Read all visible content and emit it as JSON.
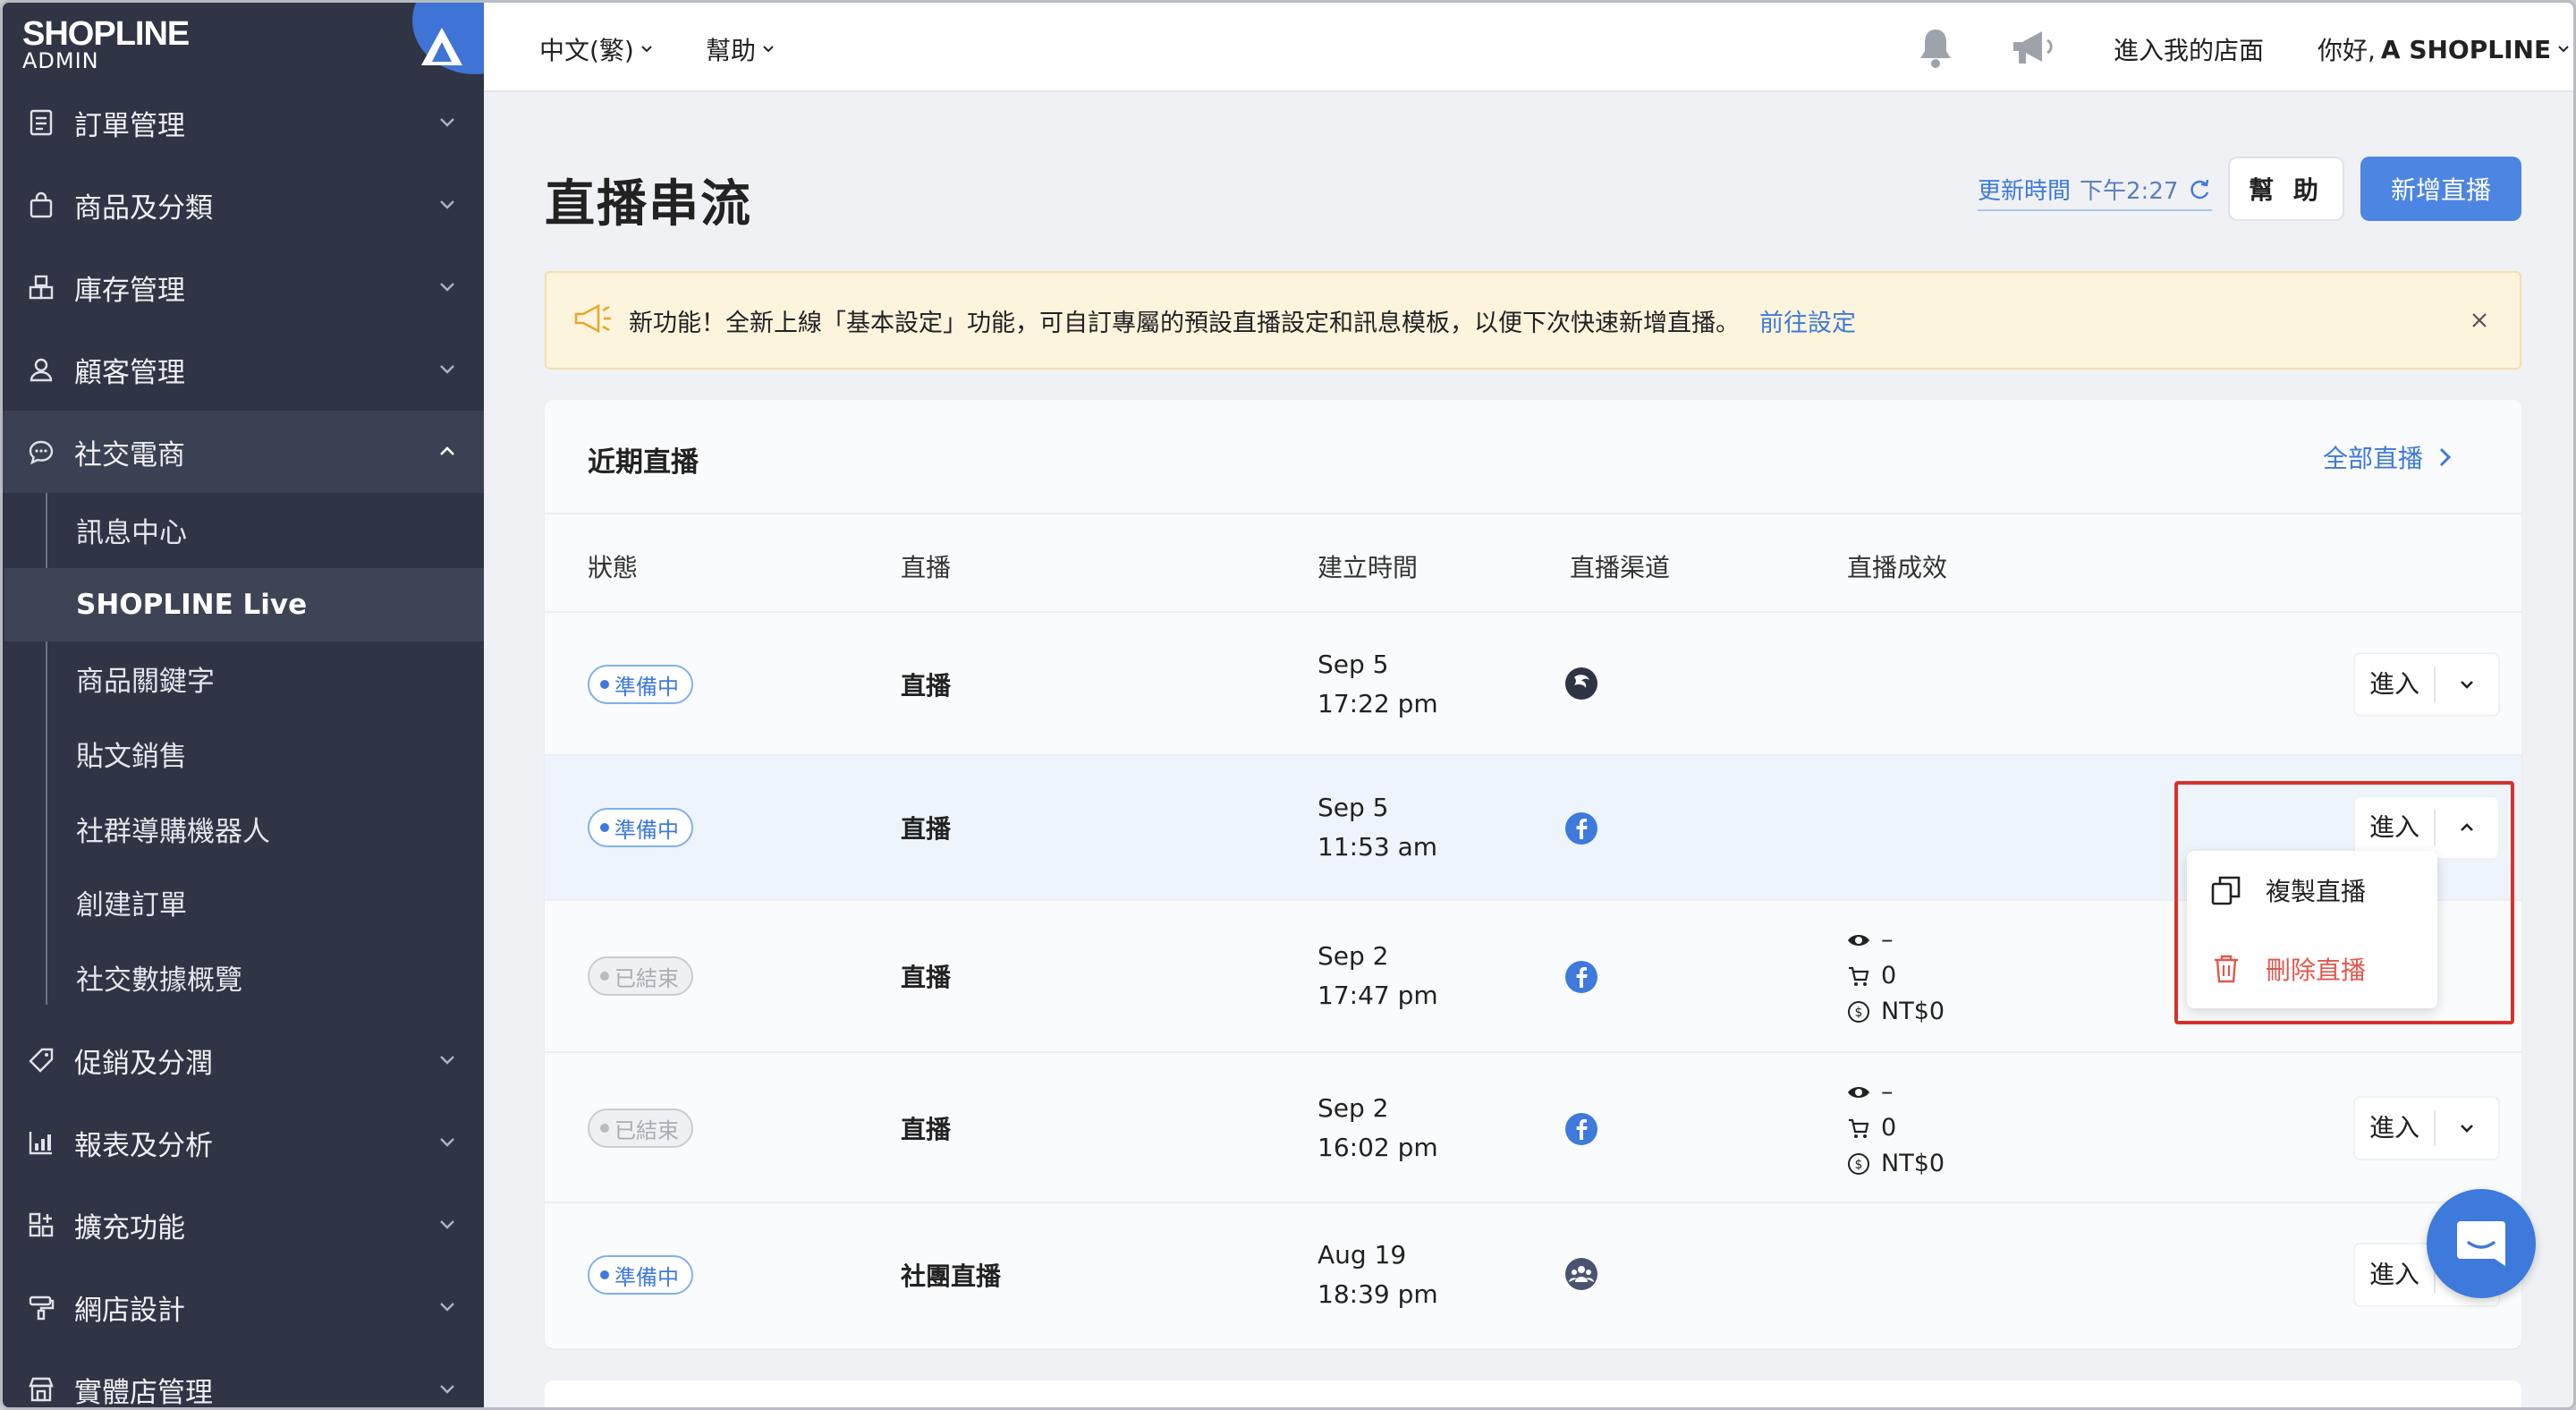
{
  "brand": {
    "logo": "SHOPLINE",
    "sub": "ADMIN",
    "accent": "#3f74d6"
  },
  "sidebar": {
    "items": [
      {
        "label": "訂單管理",
        "icon": "order-icon"
      },
      {
        "label": "商品及分類",
        "icon": "bag-icon"
      },
      {
        "label": "庫存管理",
        "icon": "inventory-icon"
      },
      {
        "label": "顧客管理",
        "icon": "user-icon"
      },
      {
        "label": "社交電商",
        "icon": "chat-icon"
      },
      {
        "label": "促銷及分潤",
        "icon": "tag-icon"
      },
      {
        "label": "報表及分析",
        "icon": "report-icon"
      },
      {
        "label": "擴充功能",
        "icon": "apps-icon"
      },
      {
        "label": "網店設計",
        "icon": "brush-icon"
      },
      {
        "label": "實體店管理",
        "icon": "store-icon"
      }
    ],
    "sub_items": [
      {
        "label": "訊息中心"
      },
      {
        "label": "SHOPLINE Live"
      },
      {
        "label": "商品關鍵字"
      },
      {
        "label": "貼文銷售"
      },
      {
        "label": "社群導購機器人"
      },
      {
        "label": "創建訂單"
      },
      {
        "label": "社交數據概覽"
      }
    ]
  },
  "topbar": {
    "language": "中文(繁)",
    "help": "幫助",
    "store_link": "進入我的店面",
    "greeting": "你好,",
    "user": "A SHOPLINE"
  },
  "page": {
    "title": "直播串流",
    "refresh_label": "更新時間",
    "refresh_time": "下午2:27",
    "help_button": "幫 助",
    "new_button": "新增直播"
  },
  "notice": {
    "text": "新功能！全新上線「基本設定」功能，可自訂專屬的預設直播設定和訊息模板，以便下次快速新增直播。",
    "link": "前往設定"
  },
  "card": {
    "title": "近期直播",
    "all_link": "全部直播",
    "columns": [
      "狀態",
      "直播",
      "建立時間",
      "直播渠道",
      "直播成效"
    ],
    "rows": [
      {
        "status": "準備中",
        "name": "直播",
        "date": "Sep 5",
        "time": "17:22 pm",
        "channel": "shopline-channel-icon",
        "views": "",
        "carts": "",
        "sales": "",
        "action": "進入"
      },
      {
        "status": "準備中",
        "name": "直播",
        "date": "Sep 5",
        "time": "11:53 am",
        "channel": "facebook-icon",
        "views": "",
        "carts": "",
        "sales": "",
        "action": "進入"
      },
      {
        "status": "已結束",
        "name": "直播",
        "date": "Sep 2",
        "time": "17:47 pm",
        "channel": "facebook-icon",
        "views": "–",
        "carts": "0",
        "sales": "NT$0",
        "action": "進入"
      },
      {
        "status": "已結束",
        "name": "直播",
        "date": "Sep 2",
        "time": "16:02 pm",
        "channel": "facebook-icon",
        "views": "–",
        "carts": "0",
        "sales": "NT$0",
        "action": "進入"
      },
      {
        "status": "準備中",
        "name": "社團直播",
        "date": "Aug 19",
        "time": "18:39 pm",
        "channel": "group-icon",
        "views": "",
        "carts": "",
        "sales": "",
        "action": "進入"
      }
    ]
  },
  "dropdown": {
    "copy": "複製直播",
    "delete": "刪除直播"
  },
  "colors": {
    "primary": "#4d85e2",
    "danger": "#e2574c",
    "sidebar_bg": "#2f3545"
  }
}
